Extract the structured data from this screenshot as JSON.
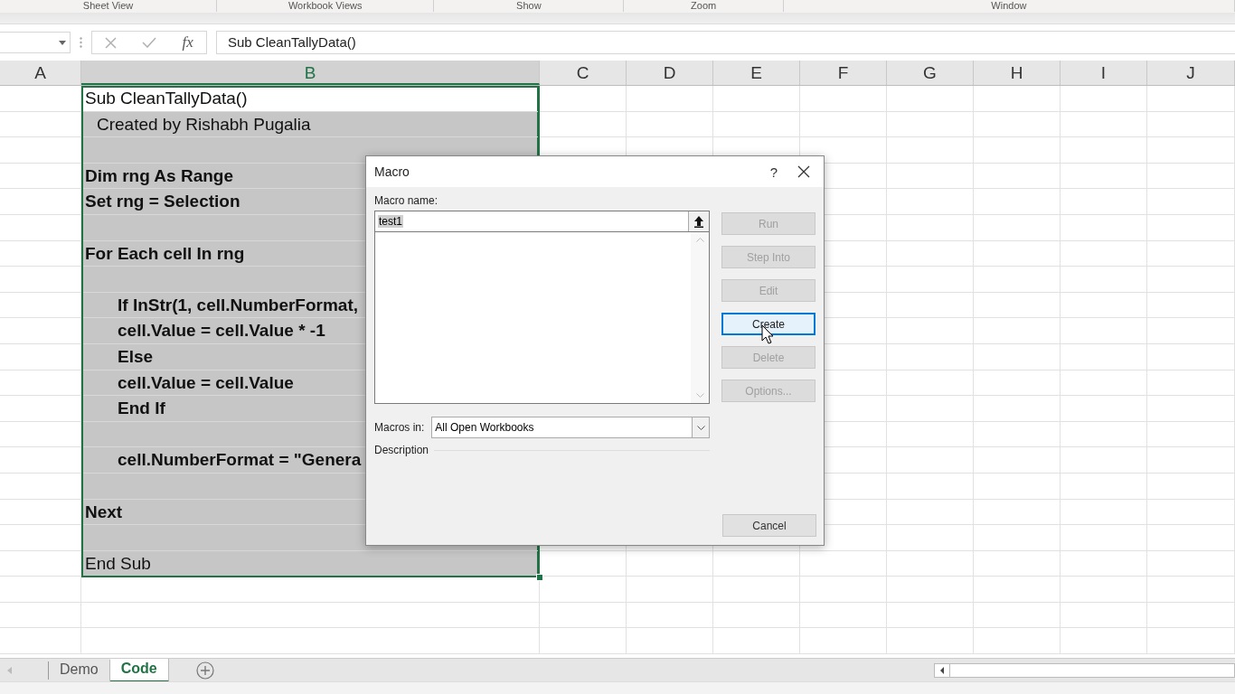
{
  "ribbon_groups": [
    "Sheet View",
    "Workbook Views",
    "Show",
    "Zoom",
    "Window"
  ],
  "formula_bar": {
    "fx": "fx",
    "value": "Sub CleanTallyData()"
  },
  "columns": [
    {
      "label": "A",
      "selected": false
    },
    {
      "label": "B",
      "selected": true
    },
    {
      "label": "C",
      "selected": false
    },
    {
      "label": "D",
      "selected": false
    },
    {
      "label": "E",
      "selected": false
    },
    {
      "label": "F",
      "selected": false
    },
    {
      "label": "G",
      "selected": false
    },
    {
      "label": "H",
      "selected": false
    },
    {
      "label": "I",
      "selected": false
    },
    {
      "label": "J",
      "selected": false
    }
  ],
  "rows": [
    {
      "text": "Sub CleanTallyData()",
      "kind": "code",
      "bold": false,
      "selected": true,
      "active": true
    },
    {
      "text": "Created by Rishabh Pugalia",
      "kind": "comment",
      "bold": false,
      "selected": true,
      "active": false
    },
    {
      "text": "",
      "selected": true,
      "active": false
    },
    {
      "text": "Dim rng As Range",
      "kind": "code",
      "bold": true,
      "selected": true,
      "active": false
    },
    {
      "text": "Set rng = Selection",
      "kind": "code",
      "bold": true,
      "selected": true,
      "active": false
    },
    {
      "text": "",
      "selected": true,
      "active": false
    },
    {
      "text": "For Each cell In rng",
      "kind": "code",
      "bold": true,
      "selected": true,
      "active": false
    },
    {
      "text": "",
      "selected": true,
      "active": false
    },
    {
      "text": "If InStr(1, cell.NumberFormat,",
      "kind": "nested",
      "bold": true,
      "selected": true,
      "active": false
    },
    {
      "text": "cell.Value = cell.Value * -1",
      "kind": "nested",
      "bold": true,
      "selected": true,
      "active": false
    },
    {
      "text": "Else",
      "kind": "nested",
      "bold": true,
      "selected": true,
      "active": false
    },
    {
      "text": "cell.Value = cell.Value",
      "kind": "nested",
      "bold": true,
      "selected": true,
      "active": false
    },
    {
      "text": "End If",
      "kind": "nested",
      "bold": true,
      "selected": true,
      "active": false
    },
    {
      "text": "",
      "selected": true,
      "active": false
    },
    {
      "text": "cell.NumberFormat = \"Genera",
      "kind": "nested",
      "bold": true,
      "selected": true,
      "active": false
    },
    {
      "text": "",
      "selected": true,
      "active": false
    },
    {
      "text": "Next",
      "kind": "code",
      "bold": true,
      "selected": true,
      "active": false
    },
    {
      "text": "",
      "selected": true,
      "active": false
    },
    {
      "text": "End Sub",
      "kind": "code",
      "bold": false,
      "selected": true,
      "active": false
    },
    {
      "text": "",
      "selected": false,
      "active": false
    },
    {
      "text": "",
      "selected": false,
      "active": false
    },
    {
      "text": "",
      "selected": false,
      "active": false
    }
  ],
  "dialog": {
    "title": "Macro",
    "help": "?",
    "name_label": "Macro name:",
    "name_value": "test1",
    "buttons": [
      {
        "label": "Run",
        "disabled": true,
        "focused": false
      },
      {
        "label": "Step Into",
        "disabled": true,
        "focused": false
      },
      {
        "label": "Edit",
        "disabled": true,
        "focused": false
      },
      {
        "label": "Create",
        "disabled": false,
        "focused": true
      },
      {
        "label": "Delete",
        "disabled": true,
        "focused": false
      },
      {
        "label": "Options...",
        "disabled": true,
        "focused": false
      }
    ],
    "macros_in_label": "Macros in:",
    "macros_in_value": "All Open Workbooks",
    "description_label": "Description",
    "cancel": "Cancel"
  },
  "sheet_tabs": [
    {
      "label": "Demo",
      "selected": false
    },
    {
      "label": "Code",
      "selected": true
    }
  ]
}
